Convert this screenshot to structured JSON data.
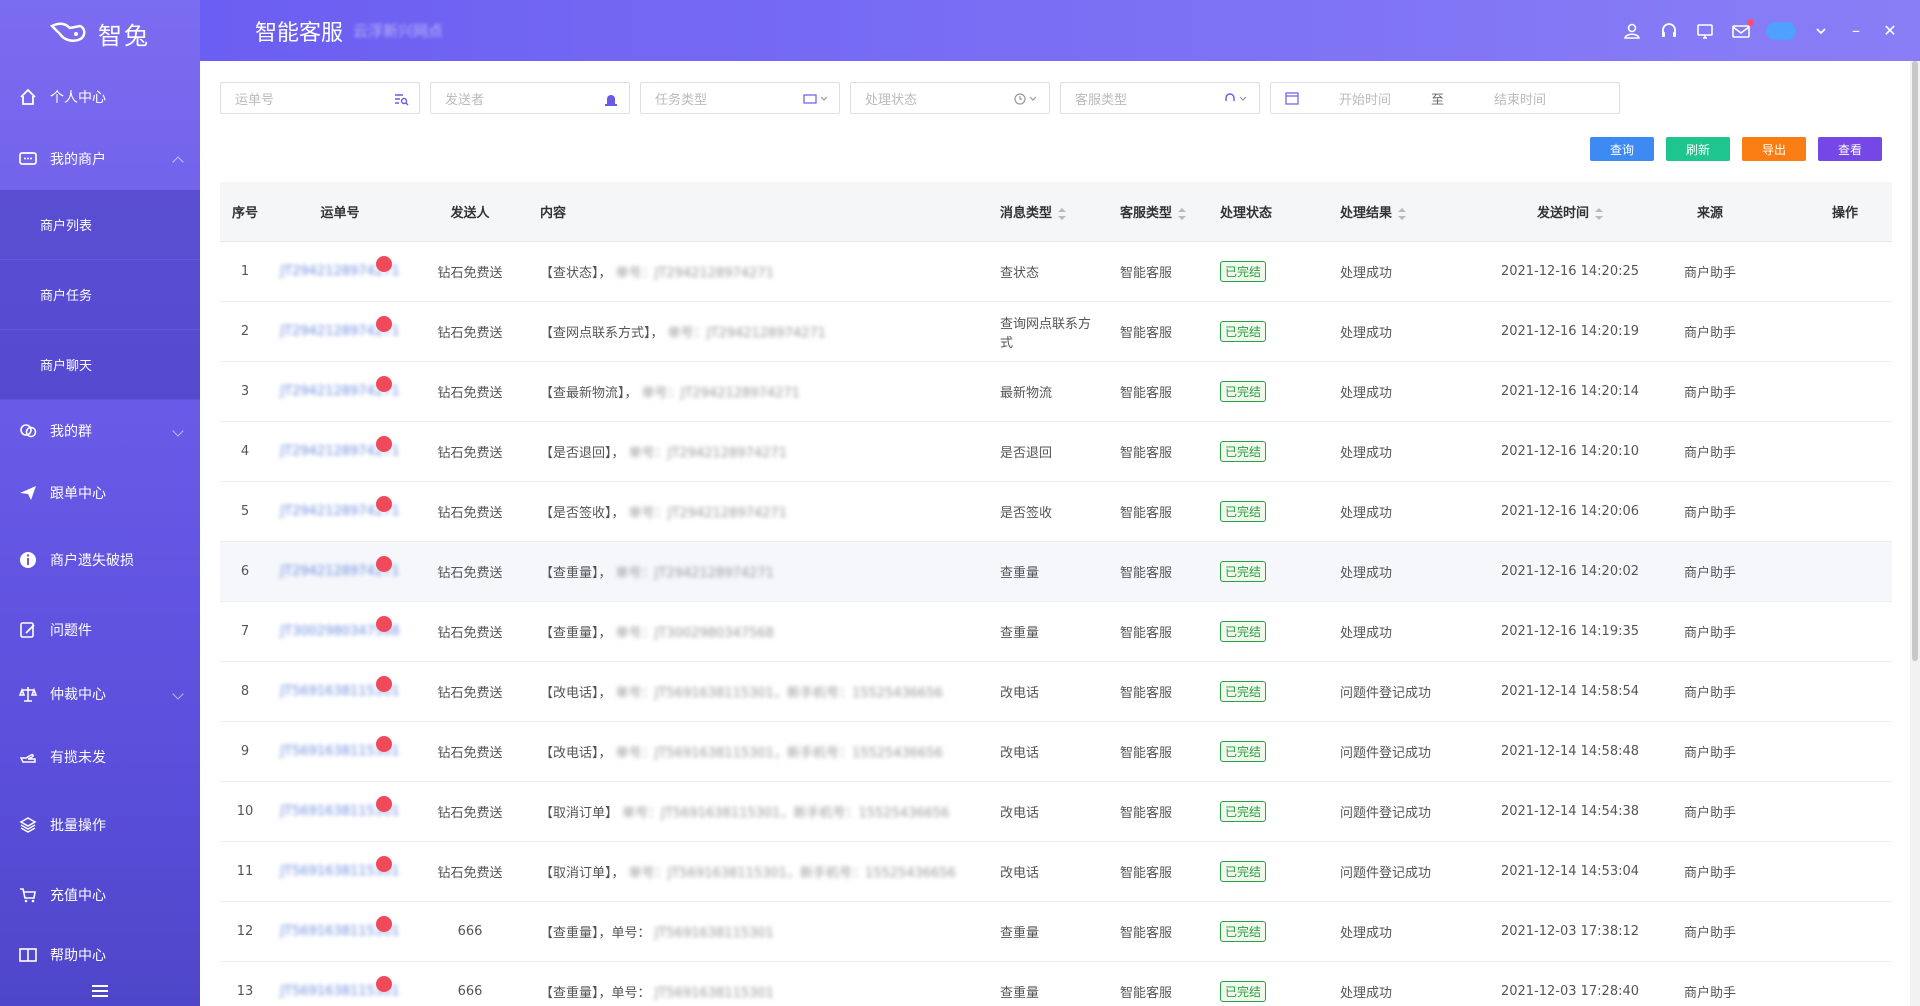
{
  "app": {
    "name": "智兔"
  },
  "header": {
    "title": "智能客服",
    "subtitle": "云浮新兴网点"
  },
  "sidebar": {
    "items": [
      {
        "label": "个人中心",
        "icon": "home-icon"
      },
      {
        "label": "我的商户",
        "icon": "chat-bubble-icon"
      },
      {
        "label": "我的群",
        "icon": "group-chat-icon"
      },
      {
        "label": "跟单中心",
        "icon": "paper-plane-icon"
      },
      {
        "label": "商户遗失破损",
        "icon": "info-icon"
      },
      {
        "label": "问题件",
        "icon": "edit-doc-icon"
      },
      {
        "label": "仲裁中心",
        "icon": "scale-icon"
      },
      {
        "label": "有揽未发",
        "icon": "hand-icon"
      },
      {
        "label": "批量操作",
        "icon": "layers-icon"
      },
      {
        "label": "充值中心",
        "icon": "cart-icon"
      },
      {
        "label": "帮助中心",
        "icon": "book-icon"
      }
    ],
    "subitems": [
      "商户列表",
      "商户任务",
      "商户聊天"
    ]
  },
  "filters": {
    "bill_no": "运单号",
    "sender": "发送者",
    "task_type": "任务类型",
    "status": "处理状态",
    "service_type": "客服类型",
    "start_time": "开始时间",
    "range_sep": "至",
    "end_time": "结束时间"
  },
  "actions": {
    "query": "查询",
    "refresh": "刷新",
    "export": "导出",
    "view": "查看",
    "colors": {
      "query": "#3d8bf2",
      "refresh": "#1ec58f",
      "export": "#fa7d14",
      "view": "#7447e6"
    }
  },
  "table": {
    "headers": {
      "no": "序号",
      "bill": "运单号",
      "sender": "发送人",
      "content": "内容",
      "msg_type": "消息类型",
      "svc_type": "客服类型",
      "state": "处理状态",
      "result": "处理结果",
      "time": "发送时间",
      "source": "来源",
      "op": "操作"
    },
    "rows": [
      {
        "no": "1",
        "bill": "JT2942128974271",
        "sender": "钻石免费送",
        "content_head": "【查状态】，",
        "content_tail": "单号：JT2942128974271",
        "type": "查状态",
        "svc": "智能客服",
        "state": "已完结",
        "result": "处理成功",
        "time": "2021-12-16 14:20:25",
        "source": "商户助手"
      },
      {
        "no": "2",
        "bill": "JT2942128974271",
        "sender": "钻石免费送",
        "content_head": "【查网点联系方式】，",
        "content_tail": "单号：JT2942128974271",
        "type": "查询网点联系方式",
        "svc": "智能客服",
        "state": "已完结",
        "result": "处理成功",
        "time": "2021-12-16 14:20:19",
        "source": "商户助手"
      },
      {
        "no": "3",
        "bill": "JT2942128974271",
        "sender": "钻石免费送",
        "content_head": "【查最新物流】，",
        "content_tail": "单号：JT2942128974271",
        "type": "最新物流",
        "svc": "智能客服",
        "state": "已完结",
        "result": "处理成功",
        "time": "2021-12-16 14:20:14",
        "source": "商户助手"
      },
      {
        "no": "4",
        "bill": "JT2942128974271",
        "sender": "钻石免费送",
        "content_head": "【是否退回】，",
        "content_tail": "单号：JT2942128974271",
        "type": "是否退回",
        "svc": "智能客服",
        "state": "已完结",
        "result": "处理成功",
        "time": "2021-12-16 14:20:10",
        "source": "商户助手"
      },
      {
        "no": "5",
        "bill": "JT2942128974271",
        "sender": "钻石免费送",
        "content_head": "【是否签收】，",
        "content_tail": "单号：JT2942128974271",
        "type": "是否签收",
        "svc": "智能客服",
        "state": "已完结",
        "result": "处理成功",
        "time": "2021-12-16 14:20:06",
        "source": "商户助手"
      },
      {
        "no": "6",
        "bill": "JT2942128974271",
        "sender": "钻石免费送",
        "content_head": "【查重量】，",
        "content_tail": "单号：JT2942128974271",
        "type": "查重量",
        "svc": "智能客服",
        "state": "已完结",
        "result": "处理成功",
        "time": "2021-12-16 14:20:02",
        "source": "商户助手"
      },
      {
        "no": "7",
        "bill": "JT3002980347568",
        "sender": "钻石免费送",
        "content_head": "【查重量】，",
        "content_tail": "单号：JT3002980347568",
        "type": "查重量",
        "svc": "智能客服",
        "state": "已完结",
        "result": "处理成功",
        "time": "2021-12-16 14:19:35",
        "source": "商户助手"
      },
      {
        "no": "8",
        "bill": "JT5691638115301",
        "sender": "钻石免费送",
        "content_head": "【改电话】，",
        "content_tail": "单号：JT5691638115301，新手机号：15525436656",
        "type": "改电话",
        "svc": "智能客服",
        "state": "已完结",
        "result": "问题件登记成功",
        "time": "2021-12-14 14:58:54",
        "source": "商户助手"
      },
      {
        "no": "9",
        "bill": "JT5691638115301",
        "sender": "钻石免费送",
        "content_head": "【改电话】，",
        "content_tail": "单号：JT5691638115301，新手机号：15525436656",
        "type": "改电话",
        "svc": "智能客服",
        "state": "已完结",
        "result": "问题件登记成功",
        "time": "2021-12-14 14:58:48",
        "source": "商户助手"
      },
      {
        "no": "10",
        "bill": "JT5691638115301",
        "sender": "钻石免费送",
        "content_head": "【取消订单】",
        "content_tail": "单号：JT5691638115301，新手机号：15525436656",
        "type": "改电话",
        "svc": "智能客服",
        "state": "已完结",
        "result": "问题件登记成功",
        "time": "2021-12-14 14:54:38",
        "source": "商户助手"
      },
      {
        "no": "11",
        "bill": "JT5691638115301",
        "sender": "钻石免费送",
        "content_head": "【取消订单】，",
        "content_tail": "单号：JT5691638115301，新手机号：15525436656",
        "type": "改电话",
        "svc": "智能客服",
        "state": "已完结",
        "result": "问题件登记成功",
        "time": "2021-12-14 14:53:04",
        "source": "商户助手"
      },
      {
        "no": "12",
        "bill": "JT5691638115301",
        "sender": "666",
        "content_head": "【查重量】，单号：",
        "content_tail": "JT5691638115301",
        "type": "查重量",
        "svc": "智能客服",
        "state": "已完结",
        "result": "处理成功",
        "time": "2021-12-03 17:38:12",
        "source": "商户助手"
      },
      {
        "no": "13",
        "bill": "JT5691638115301",
        "sender": "666",
        "content_head": "【查重量】，单号：",
        "content_tail": "JT5691638115301",
        "type": "查重量",
        "svc": "智能客服",
        "state": "已完结",
        "result": "处理成功",
        "time": "2021-12-03 17:28:40",
        "source": "商户助手"
      }
    ]
  }
}
